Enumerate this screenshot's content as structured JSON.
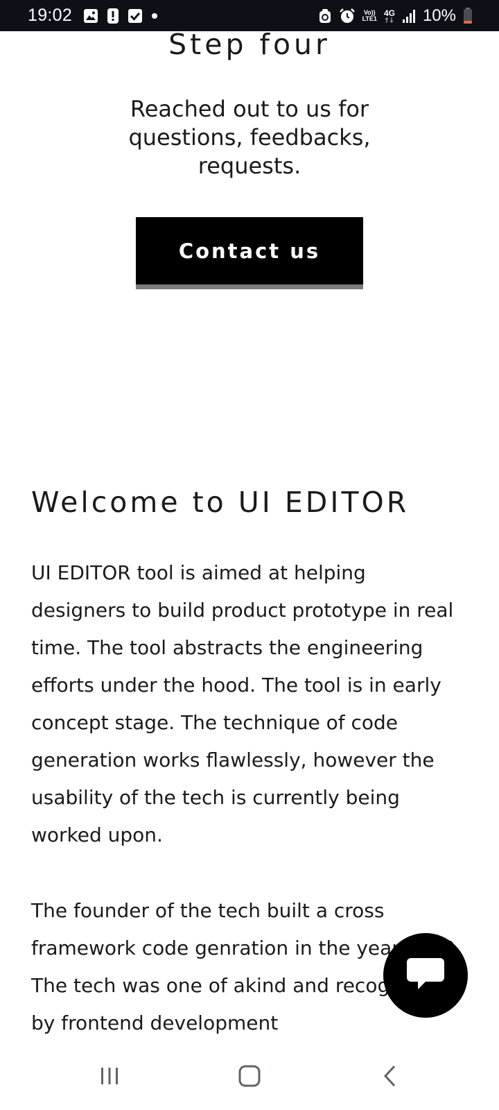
{
  "status_bar": {
    "time": "19:02",
    "network_top": "Vo))",
    "network_bottom": "LTE1",
    "network_type": "4G",
    "battery": "10%",
    "icons": [
      "gallery-icon",
      "alert-icon",
      "checkbox-icon",
      "dot-icon",
      "sync-icon",
      "alarm-icon",
      "volte-icon",
      "network-4g-icon",
      "signal-icon",
      "battery-icon"
    ],
    "battery_level": 0.1,
    "battery_color": "#e8684a"
  },
  "step": {
    "title": "Step four",
    "description": "Reached out to us for questions, feedbacks, requests.",
    "button_label": "Contact us"
  },
  "welcome": {
    "title": "Welcome to UI EDITOR",
    "paragraph_1": "UI EDITOR tool is aimed at helping designers to build product prototype in real time. The tool abstracts the engineering efforts under the hood. The tool is in early concept stage. The technique of code generation works flawlessly, however the usability of the tech is currently being worked upon.",
    "paragraph_2": "The founder of the tech built a cross framework code genration in the year 2019. The tech was one of akind and recognised by frontend development"
  },
  "chat": {
    "icon": "chat-icon"
  },
  "navigation": {
    "icons": [
      "recent-apps-icon",
      "home-icon",
      "back-icon"
    ]
  },
  "colors": {
    "status_bar_bg": "#0d1117",
    "button_bg": "#000000",
    "button_underline": "#7a7a7a",
    "text": "#1a1a1a"
  }
}
